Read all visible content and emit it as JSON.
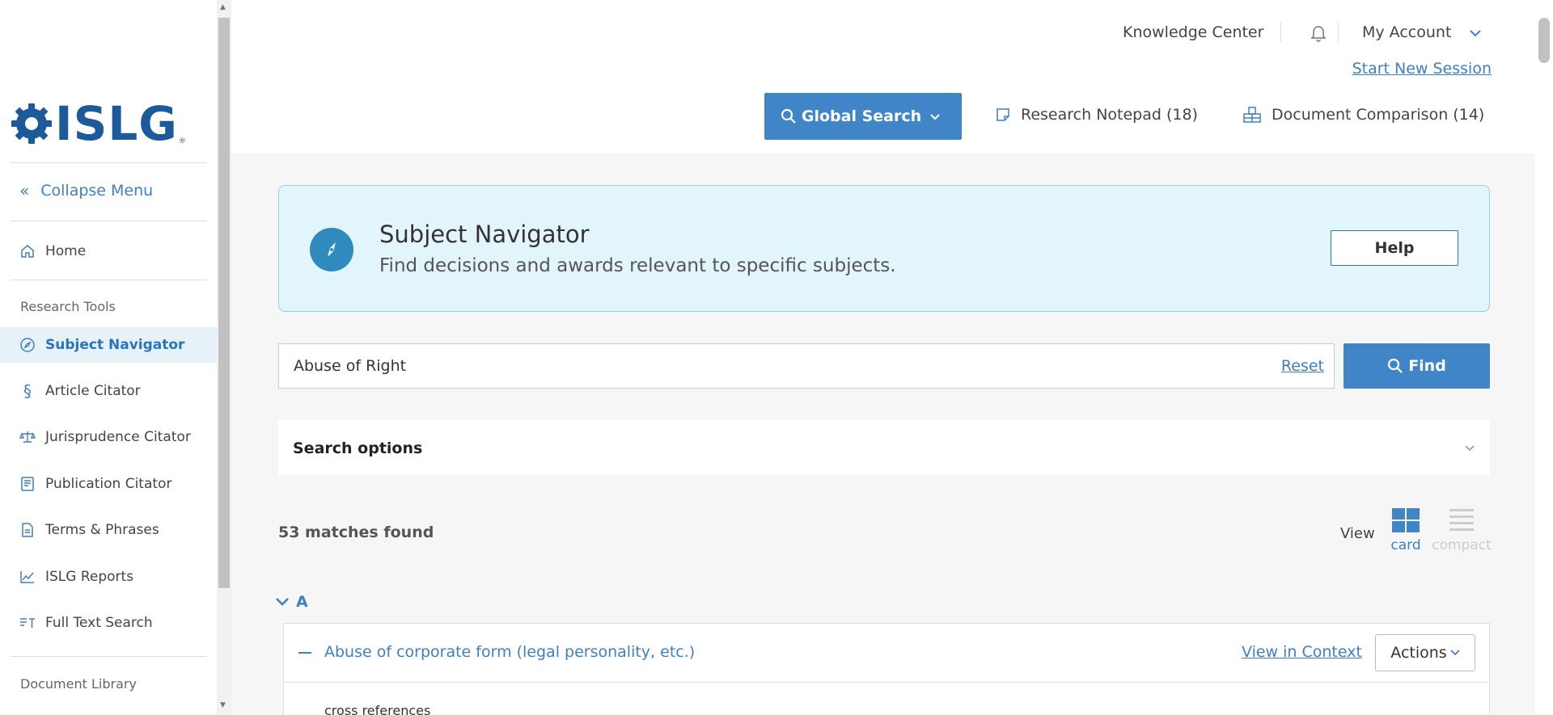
{
  "logo": {
    "text": "ISLG",
    "reg": "®"
  },
  "sidebar": {
    "collapse_label": "Collapse Menu",
    "home_label": "Home",
    "section_research": "Research Tools",
    "items": [
      {
        "label": "Subject Navigator",
        "icon": "compass-icon"
      },
      {
        "label": "Article Citator",
        "icon": "section-icon"
      },
      {
        "label": "Jurisprudence Citator",
        "icon": "scales-icon"
      },
      {
        "label": "Publication Citator",
        "icon": "book-icon"
      },
      {
        "label": "Terms & Phrases",
        "icon": "document-icon"
      },
      {
        "label": "ISLG Reports",
        "icon": "chart-icon"
      },
      {
        "label": "Full Text Search",
        "icon": "text-search-icon"
      }
    ],
    "section_library": "Document Library"
  },
  "header": {
    "knowledge_center": "Knowledge Center",
    "my_account": "My Account",
    "start_new_session": "Start New Session",
    "global_search": "Global Search",
    "research_notepad": "Research Notepad (18)",
    "document_comparison": "Document Comparison (14)"
  },
  "banner": {
    "title": "Subject Navigator",
    "subtitle": "Find decisions and awards relevant to specific subjects.",
    "help_label": "Help"
  },
  "search": {
    "value": "Abuse of Right",
    "reset_label": "Reset",
    "find_label": "Find"
  },
  "search_options": {
    "label": "Search options"
  },
  "results": {
    "matches_label": "53 matches found",
    "view_label": "View",
    "view_card": "card",
    "view_compact": "compact",
    "group_letter": "A",
    "entries": [
      {
        "title": "Abuse of corporate form (legal personality, etc.)",
        "view_in_context": "View in Context",
        "actions_label": "Actions",
        "sub_label": "cross references"
      }
    ]
  },
  "colors": {
    "accent": "#3f85c8",
    "link": "#3f7fc4",
    "banner_bg": "#e1f5fb",
    "active_nav_bg": "#e6f2f8"
  }
}
